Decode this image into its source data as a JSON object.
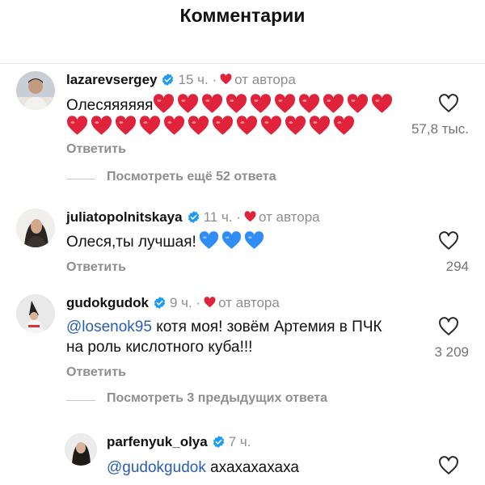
{
  "header": {
    "title": "Комментарии"
  },
  "comments": [
    {
      "username": "lazarevsergey",
      "time": "15 ч.",
      "dot": "·",
      "author_like": "от автора",
      "text": "Олесяяяяяя",
      "hearts_line1": 10,
      "hearts_line2": 12,
      "reply_label": "Ответить",
      "likes": "57,8 тыс.",
      "view_more": "Посмотреть ещё 52 ответа"
    },
    {
      "username": "juliatopolnitskaya",
      "time": "11 ч.",
      "dot": "·",
      "author_like": "от автора",
      "text": "Олеся,ты лучшая!",
      "blue_hearts": 3,
      "reply_label": "Ответить",
      "likes": "294"
    },
    {
      "username": "gudokgudok",
      "time": "9 ч.",
      "dot": "·",
      "author_like": "от автора",
      "mention": "@losenok95",
      "text": " котя моя! зовём Артемия в ПЧК на роль кислотного куба!!!",
      "reply_label": "Ответить",
      "likes": "3 209",
      "view_more": "Посмотреть 3 предыдущих ответа"
    },
    {
      "username": "parfenyuk_olya",
      "time": "7 ч.",
      "mention": "@gudokgudok",
      "text": " ахахахахаха"
    }
  ],
  "colors": {
    "heart_red": "#e0223a",
    "verified_blue": "#1d9bf0",
    "emoji_blue": "#2f8df5",
    "mention": "#2a5db0",
    "muted": "#8e8e8e"
  },
  "icons": {
    "like": "heart-outline-icon",
    "verified": "verified-badge-icon",
    "author_like": "red-heart-icon"
  }
}
